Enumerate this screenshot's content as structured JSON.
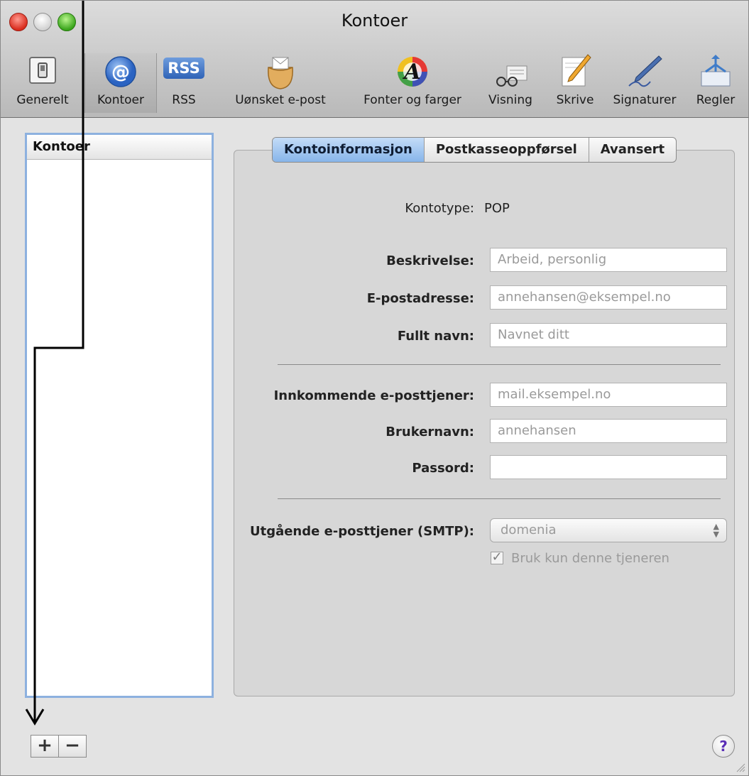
{
  "window": {
    "title": "Kontoer"
  },
  "toolbar": {
    "items": [
      {
        "label": "Generelt",
        "icon": "switch-icon"
      },
      {
        "label": "Kontoer",
        "icon": "at-icon",
        "selected": true
      },
      {
        "label": "RSS",
        "icon": "rss-icon",
        "badge": "RSS"
      },
      {
        "label": "Uønsket e-post",
        "icon": "junk-mail-bag-icon"
      },
      {
        "label": "Fonter og farger",
        "icon": "font-color-icon",
        "glyph": "A"
      },
      {
        "label": "Visning",
        "icon": "glasses-icon"
      },
      {
        "label": "Skrive",
        "icon": "pencil-icon"
      },
      {
        "label": "Signaturer",
        "icon": "fountain-pen-icon"
      },
      {
        "label": "Regler",
        "icon": "rules-icon"
      }
    ]
  },
  "sidebar": {
    "header": "Kontoer",
    "add_label": "+",
    "remove_label": "−"
  },
  "tabs": [
    {
      "label": "Kontoinformasjon",
      "active": true
    },
    {
      "label": "Postkasseoppførsel",
      "active": false
    },
    {
      "label": "Avansert",
      "active": false
    }
  ],
  "form": {
    "account_type_label": "Kontotype:",
    "account_type_value": "POP",
    "description_label": "Beskrivelse:",
    "description_placeholder": "Arbeid, personlig",
    "email_label": "E-postadresse:",
    "email_placeholder": "annehansen@eksempel.no",
    "fullname_label": "Fullt navn:",
    "fullname_placeholder": "Navnet ditt",
    "incoming_label": "Innkommende e-posttjener:",
    "incoming_placeholder": "mail.eksempel.no",
    "username_label": "Brukernavn:",
    "username_placeholder": "annehansen",
    "password_label": "Passord:",
    "password_value": "",
    "smtp_label": "Utgående e-posttjener (SMTP):",
    "smtp_value": "domenia",
    "smtp_only_label": "Bruk kun denne tjeneren",
    "smtp_only_checked": true
  },
  "help_label": "?",
  "colors": {
    "selection_blue": "#8db1df",
    "active_tab": "#87b5ea",
    "close": "#d92b1c",
    "zoom": "#3aa51c"
  }
}
